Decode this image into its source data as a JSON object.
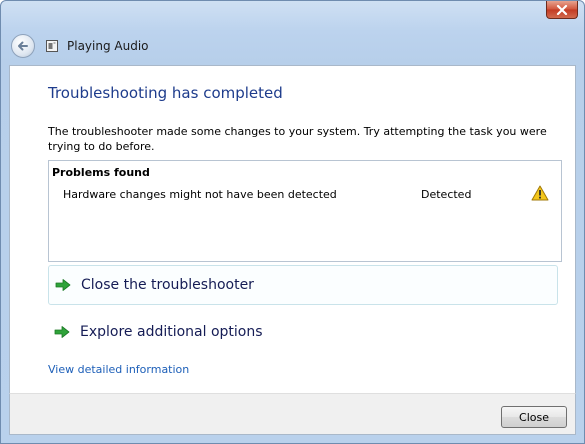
{
  "window": {
    "title": "Playing Audio",
    "close_icon": "close-x-icon"
  },
  "main": {
    "heading": "Troubleshooting has completed",
    "description": "The troubleshooter made some changes to your system. Try attempting the task you were trying to do before.",
    "problems": {
      "title": "Problems found",
      "items": [
        {
          "name": "Hardware changes might not have been detected",
          "status": "Detected",
          "icon": "warning-icon"
        }
      ]
    },
    "options": [
      {
        "label": "Close the troubleshooter",
        "icon": "green-arrow-icon"
      },
      {
        "label": "Explore additional options",
        "icon": "green-arrow-icon"
      }
    ],
    "details_link": "View detailed information"
  },
  "footer": {
    "close_label": "Close"
  },
  "colors": {
    "heading": "#1e3c8c",
    "link": "#1d5fb8",
    "arrow": "#2fa33a",
    "warning": "#f3c61b"
  }
}
